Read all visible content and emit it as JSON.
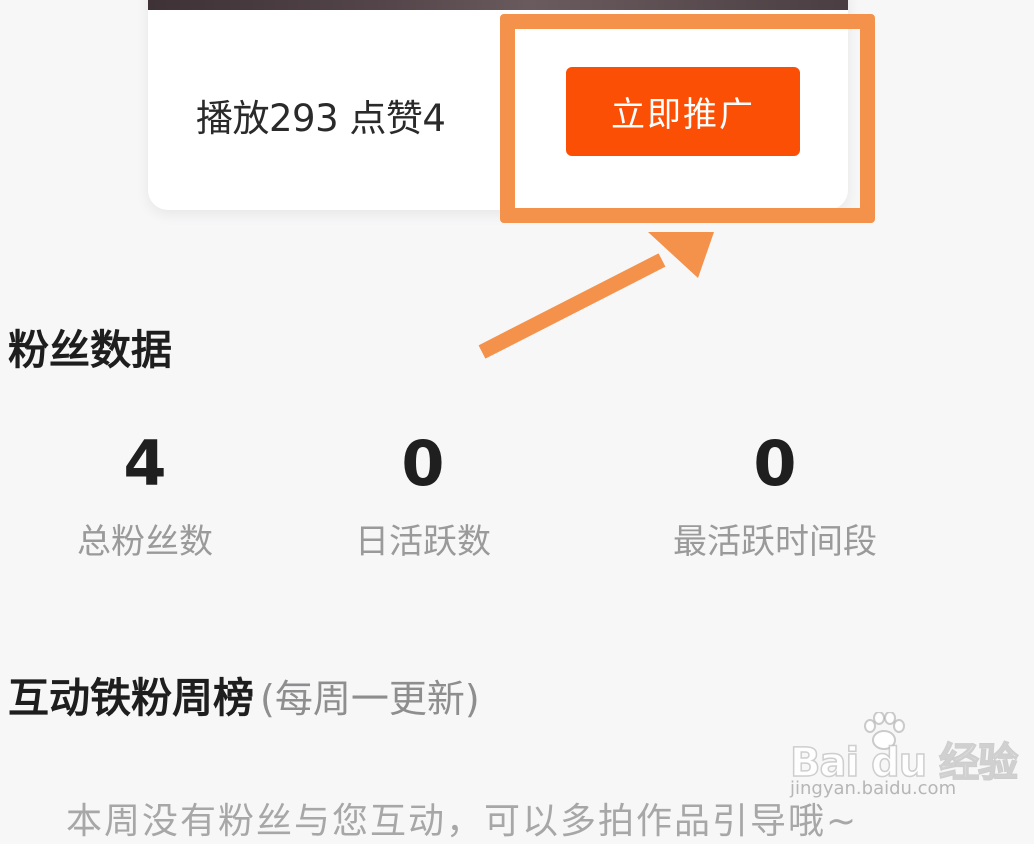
{
  "video_card": {
    "stats_text": "播放293 点赞4",
    "promote_button": "立即推广"
  },
  "fans_section": {
    "title": "粉丝数据",
    "stats": [
      {
        "value": "4",
        "label": "总粉丝数"
      },
      {
        "value": "0",
        "label": "日活跃数"
      },
      {
        "value": "0",
        "label": "最活跃时间段"
      }
    ]
  },
  "weekly_section": {
    "title": "互动铁粉周榜",
    "subtitle": "(每周一更新)",
    "empty_message": "本周没有粉丝与您互动，可以多拍作品引导哦~"
  },
  "watermark": {
    "brand": "Bai du 经验",
    "url": "jingyan.baidu.com"
  },
  "annotation": {
    "highlight_color": "#f4914a"
  },
  "colors": {
    "promote_button": "#fa4f05",
    "background": "#f7f7f8"
  }
}
